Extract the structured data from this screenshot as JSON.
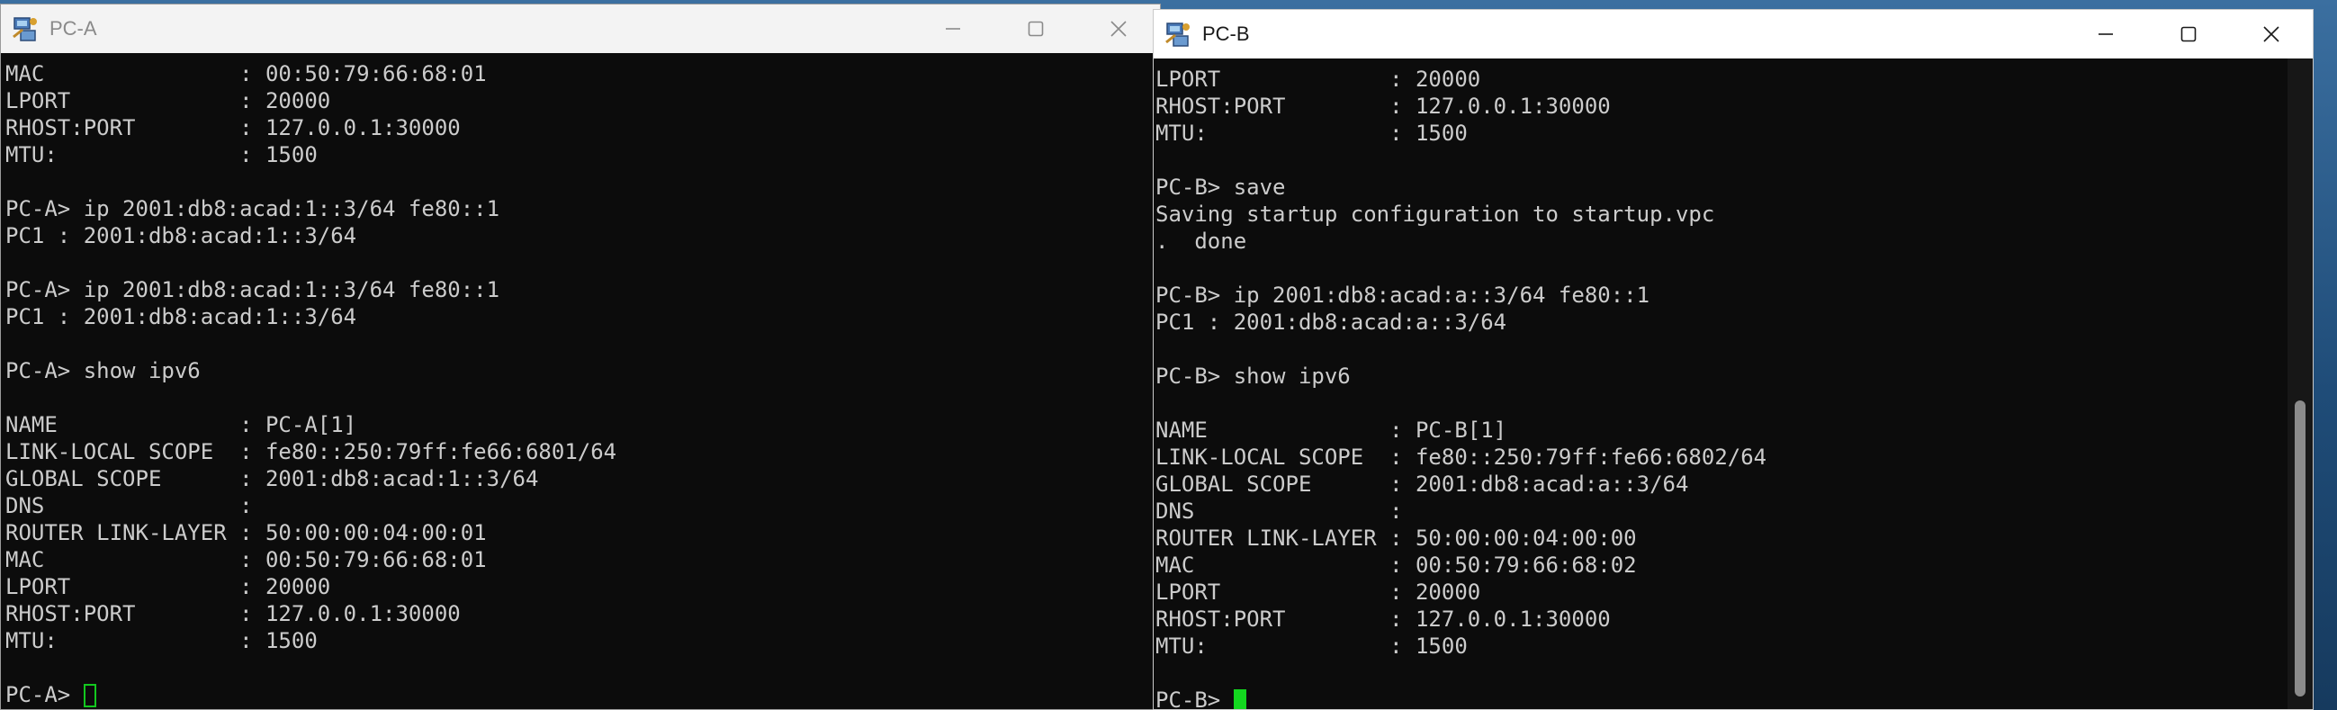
{
  "windows": {
    "pc_a": {
      "title": "PC-A",
      "icon": "vpcs-network-icon",
      "lines": [
        "MAC               : 00:50:79:66:68:01",
        "LPORT             : 20000",
        "RHOST:PORT        : 127.0.0.1:30000",
        "MTU:              : 1500",
        "",
        "PC-A> ip 2001:db8:acad:1::3/64 fe80::1",
        "PC1 : 2001:db8:acad:1::3/64",
        "",
        "PC-A> ip 2001:db8:acad:1::3/64 fe80::1",
        "PC1 : 2001:db8:acad:1::3/64",
        "",
        "PC-A> show ipv6",
        "",
        "NAME              : PC-A[1]",
        "LINK-LOCAL SCOPE  : fe80::250:79ff:fe66:6801/64",
        "GLOBAL SCOPE      : 2001:db8:acad:1::3/64",
        "DNS               :",
        "ROUTER LINK-LAYER : 50:00:00:04:00:01",
        "MAC               : 00:50:79:66:68:01",
        "LPORT             : 20000",
        "RHOST:PORT        : 127.0.0.1:30000",
        "MTU:              : 1500",
        ""
      ],
      "prompt": "PC-A> "
    },
    "pc_b": {
      "title": "PC-B",
      "icon": "vpcs-network-icon",
      "lines": [
        "LPORT             : 20000",
        "RHOST:PORT        : 127.0.0.1:30000",
        "MTU:              : 1500",
        "",
        "PC-B> save",
        "Saving startup configuration to startup.vpc",
        ".  done",
        "",
        "PC-B> ip 2001:db8:acad:a::3/64 fe80::1",
        "PC1 : 2001:db8:acad:a::3/64",
        "",
        "PC-B> show ipv6",
        "",
        "NAME              : PC-B[1]",
        "LINK-LOCAL SCOPE  : fe80::250:79ff:fe66:6802/64",
        "GLOBAL SCOPE      : 2001:db8:acad:a::3/64",
        "DNS               :",
        "ROUTER LINK-LAYER : 50:00:00:04:00:00",
        "MAC               : 00:50:79:66:68:02",
        "LPORT             : 20000",
        "RHOST:PORT        : 127.0.0.1:30000",
        "MTU:              : 1500",
        ""
      ],
      "prompt": "PC-B> "
    }
  },
  "colors": {
    "console_bg": "#0c0c0c",
    "console_text": "#cccccc",
    "cursor": "#13d81f"
  }
}
